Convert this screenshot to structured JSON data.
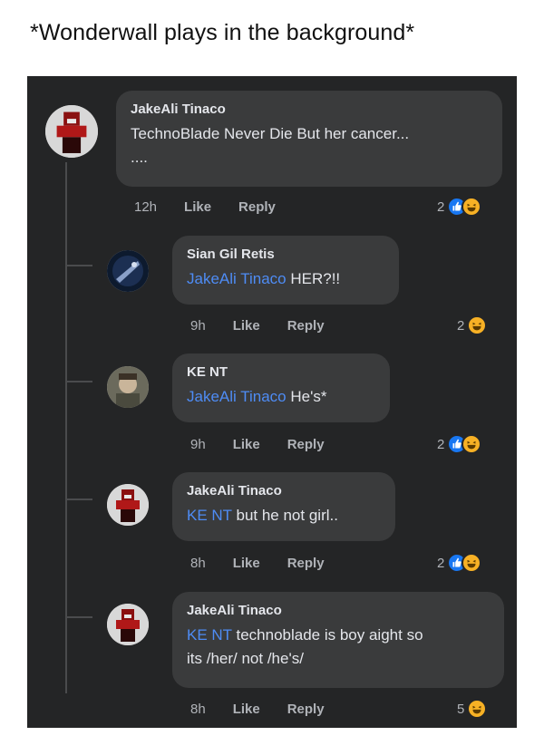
{
  "caption": "*Wonderwall plays in the background*",
  "comments": [
    {
      "author": "JakeAli Tinaco",
      "mention": "",
      "text": "TechnoBlade Never Die But her cancer...",
      "text2": "....",
      "time": "12h",
      "like": "Like",
      "reply": "Reply",
      "reaction_count": "2",
      "reactions": [
        "like-icon",
        "haha-icon"
      ]
    },
    {
      "author": "Sian Gil Retis",
      "mention": "JakeAli Tinaco",
      "text": " HER?!!",
      "time": "9h",
      "like": "Like",
      "reply": "Reply",
      "reaction_count": "2",
      "reactions": [
        "haha-icon"
      ]
    },
    {
      "author": "KE NT",
      "mention": "JakeAli Tinaco",
      "text": " He's*",
      "time": "9h",
      "like": "Like",
      "reply": "Reply",
      "reaction_count": "2",
      "reactions": [
        "like-icon",
        "haha-icon"
      ]
    },
    {
      "author": "JakeAli Tinaco",
      "mention": "KE NT",
      "text": " but he not girl..",
      "time": "8h",
      "like": "Like",
      "reply": "Reply",
      "reaction_count": "2",
      "reactions": [
        "like-icon",
        "haha-icon"
      ]
    },
    {
      "author": "JakeAli Tinaco",
      "mention": "KE NT",
      "text": " technoblade is boy aight so",
      "text2": "its /her/ not /he's/",
      "time": "8h",
      "like": "Like",
      "reply": "Reply",
      "reaction_count": "5",
      "reactions": [
        "haha-icon"
      ]
    }
  ],
  "colors": {
    "background": "#242526",
    "bubble": "#3a3b3c",
    "mention": "#4e8cf5",
    "like": "#1877f2",
    "haha": "#f7b125"
  }
}
